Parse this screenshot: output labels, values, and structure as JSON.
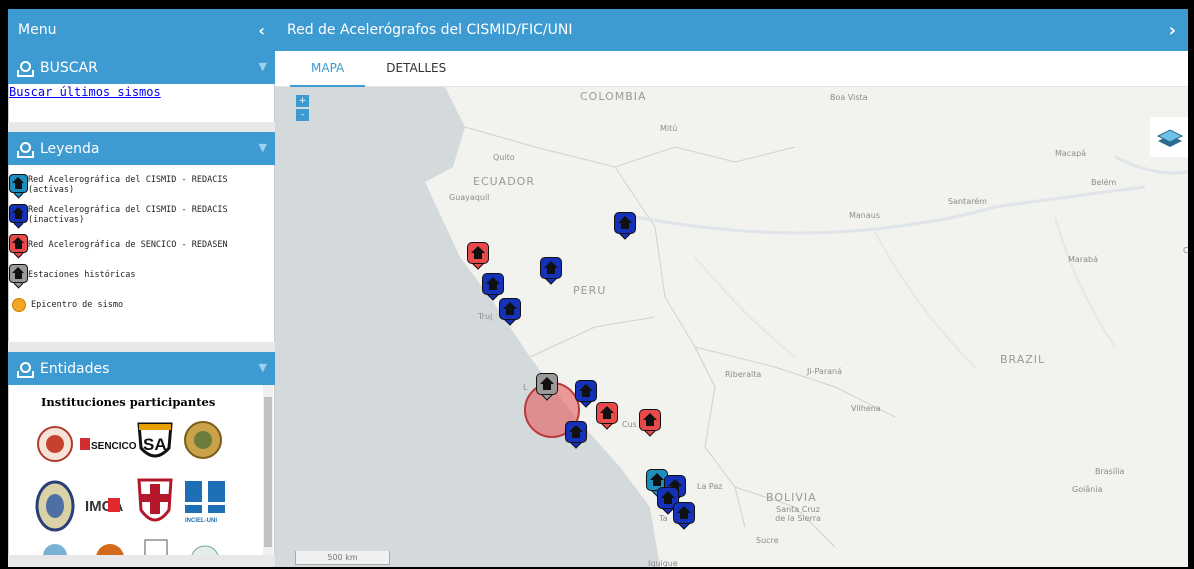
{
  "left": {
    "menu_title": "Menu",
    "menu_chevron": "‹",
    "buscar": {
      "title": "BUSCAR",
      "link": "Buscar últimos sismos"
    },
    "legend": {
      "title": "Leyenda",
      "items": [
        {
          "label": "Red Acelerográfica del CISMID - REDACIS (activas)",
          "color": "#1d8fbf"
        },
        {
          "label": "Red Acelerográfica del CISMID - REDACIS (inactivas)",
          "color": "#1431b8"
        },
        {
          "label": "Red Acelerográfica de SENCICO - REDASEN",
          "color": "#e84a4a"
        },
        {
          "label": "Estaciones históricas",
          "color": "#9a9a9a"
        },
        {
          "label": "Epicentro de sismo",
          "color": "#f5a623"
        }
      ]
    },
    "entidades": {
      "title": "Entidades",
      "subtitle": "Instituciones participantes",
      "logos": [
        "SENCICO",
        "SA",
        "IMCA",
        "VERITAS",
        "INCIEL-UNI"
      ]
    }
  },
  "right": {
    "title": "Red de Acelerógrafos del CISMID/FIC/UNI",
    "chevron": "›",
    "tabs": [
      "MAPA",
      "DETALLES"
    ],
    "active_tab": "MAPA",
    "map": {
      "zoom_in": "+",
      "zoom_out": "-",
      "scale": "500 km",
      "labels": {
        "colombia": "COLOMBIA",
        "boa_vista": "Boa Vista",
        "mitu": "Mitú",
        "quito": "Quito",
        "ecuador": "ECUADOR",
        "guayaquil": "Guayaquil",
        "macapa": "Macapá",
        "belem": "Belém",
        "santarem": "Santarém",
        "manaus": "Manaus",
        "maraba": "Marabá",
        "peru": "PERU",
        "truj": "Truj",
        "brazil": "BRAZIL",
        "riberalta": "Riberalta",
        "ji_parana": "Ji-Paraná",
        "vilhena": "Vilhena",
        "cusco": "Cus",
        "la_paz": "La Paz",
        "bolivia": "BOLIVIA",
        "santa_cruz": "Santa Cruz de la Sierra",
        "sucre": "Sucre",
        "brasilia": "Brasília",
        "goiania": "Goiânia",
        "iquique": "Iquique",
        "ta": "Ta",
        "c": "C",
        "l": "L"
      }
    }
  }
}
